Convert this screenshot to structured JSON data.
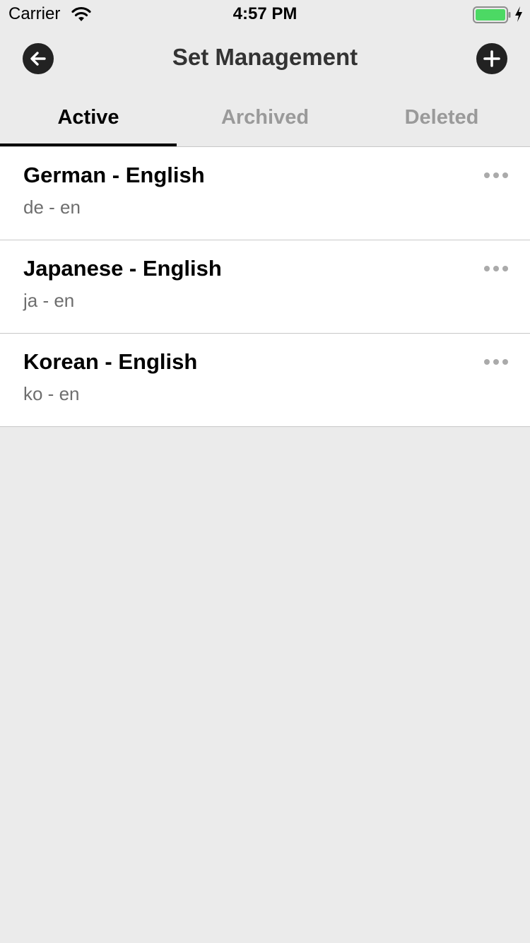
{
  "status_bar": {
    "carrier": "Carrier",
    "time": "4:57 PM",
    "battery_color": "#4cd964"
  },
  "nav": {
    "title": "Set Management",
    "back_icon": "arrow-left-icon",
    "add_icon": "plus-icon"
  },
  "tabs": [
    {
      "label": "Active",
      "active": true
    },
    {
      "label": "Archived",
      "active": false
    },
    {
      "label": "Deleted",
      "active": false
    }
  ],
  "sets": [
    {
      "title": "German - English",
      "subtitle": "de - en"
    },
    {
      "title": "Japanese - English",
      "subtitle": "ja - en"
    },
    {
      "title": "Korean - English",
      "subtitle": "ko - en"
    }
  ]
}
